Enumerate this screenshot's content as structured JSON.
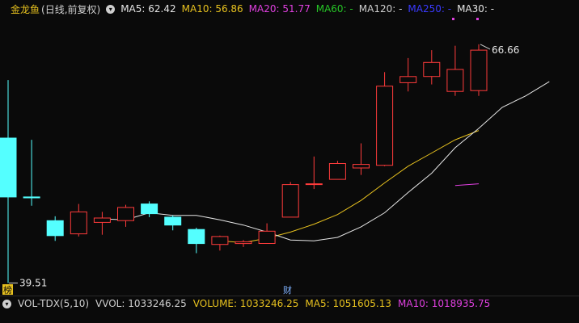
{
  "header": {
    "stock": "金龙鱼",
    "period": "(日线,前复权)",
    "ma": [
      {
        "label": "MA5: 62.42",
        "color": "#e6e6e6"
      },
      {
        "label": "MA10: 56.86",
        "color": "#e8c21f"
      },
      {
        "label": "MA20: 51.77",
        "color": "#e040e0"
      },
      {
        "label": "MA60: -",
        "color": "#26c526"
      },
      {
        "label": "MA120: -",
        "color": "#cfcfcf"
      },
      {
        "label": "MA250: -",
        "color": "#3a3aff"
      },
      {
        "label": "MA30: -",
        "color": "#e6e6e6"
      }
    ]
  },
  "volume_bar": {
    "title": "VOL-TDX(5,10)",
    "vvol": "VVOL: 1033246.25",
    "volume": "VOLUME: 1033246.25",
    "ma5": "MA5: 1051605.13",
    "ma10": "MA10: 1018935.75"
  },
  "chart_data": {
    "type": "candlestick",
    "ylim": [
      39.0,
      69.5
    ],
    "y_scale": "linear",
    "up_color": "#ff3b3b",
    "down_color": "#54ffff",
    "candles": [
      {
        "o": 56.0,
        "h": 62.6,
        "l": 39.51,
        "c": 49.3
      },
      {
        "o": 49.3,
        "h": 55.8,
        "l": 48.3,
        "c": 49.2
      },
      {
        "o": 46.6,
        "h": 47.1,
        "l": 44.3,
        "c": 44.9
      },
      {
        "o": 45.1,
        "h": 48.5,
        "l": 44.8,
        "c": 47.6
      },
      {
        "o": 46.4,
        "h": 47.6,
        "l": 45.0,
        "c": 46.9
      },
      {
        "o": 46.6,
        "h": 48.4,
        "l": 45.9,
        "c": 48.1
      },
      {
        "o": 48.5,
        "h": 48.8,
        "l": 47.0,
        "c": 47.4
      },
      {
        "o": 47.0,
        "h": 47.2,
        "l": 45.5,
        "c": 46.1
      },
      {
        "o": 45.6,
        "h": 45.8,
        "l": 42.9,
        "c": 44.0
      },
      {
        "o": 43.9,
        "h": 44.9,
        "l": 43.2,
        "c": 44.8
      },
      {
        "o": 44.0,
        "h": 44.4,
        "l": 43.6,
        "c": 44.2
      },
      {
        "o": 44.0,
        "h": 46.3,
        "l": 44.0,
        "c": 45.4
      },
      {
        "o": 47.0,
        "h": 51.0,
        "l": 47.0,
        "c": 50.7
      },
      {
        "o": 50.8,
        "h": 53.9,
        "l": 50.2,
        "c": 50.8
      },
      {
        "o": 51.3,
        "h": 53.4,
        "l": 51.3,
        "c": 53.1
      },
      {
        "o": 52.6,
        "h": 55.4,
        "l": 51.8,
        "c": 53.0
      },
      {
        "o": 52.9,
        "h": 63.5,
        "l": 52.8,
        "c": 61.9
      },
      {
        "o": 62.3,
        "h": 65.1,
        "l": 61.3,
        "c": 63.0
      },
      {
        "o": 63.0,
        "h": 66.0,
        "l": 62.1,
        "c": 64.6
      },
      {
        "o": 61.3,
        "h": 66.5,
        "l": 60.8,
        "c": 63.8
      },
      {
        "o": 61.4,
        "h": 66.66,
        "l": 60.8,
        "c": 66.0
      }
    ],
    "ma5": [
      46.8,
      46.7,
      47.5,
      47.2,
      47.2,
      46.7,
      46.1,
      45.3,
      44.4,
      44.3,
      44.7,
      45.9,
      47.5,
      49.8,
      52.0,
      54.9,
      57.1,
      59.5,
      60.8,
      62.42
    ],
    "ma10": [
      44.3,
      44.1,
      44.6,
      45.3,
      46.2,
      47.3,
      48.9,
      50.9,
      52.8,
      54.3,
      55.8,
      56.86
    ],
    "ma20": [
      50.6,
      50.8
    ],
    "ma5_start_index": 4,
    "ma10_start_index": 9,
    "ma20_start_index": 19,
    "max_label": "66.66",
    "min_label": "39.51",
    "markers": {
      "left": "榜",
      "mid": "财"
    }
  }
}
